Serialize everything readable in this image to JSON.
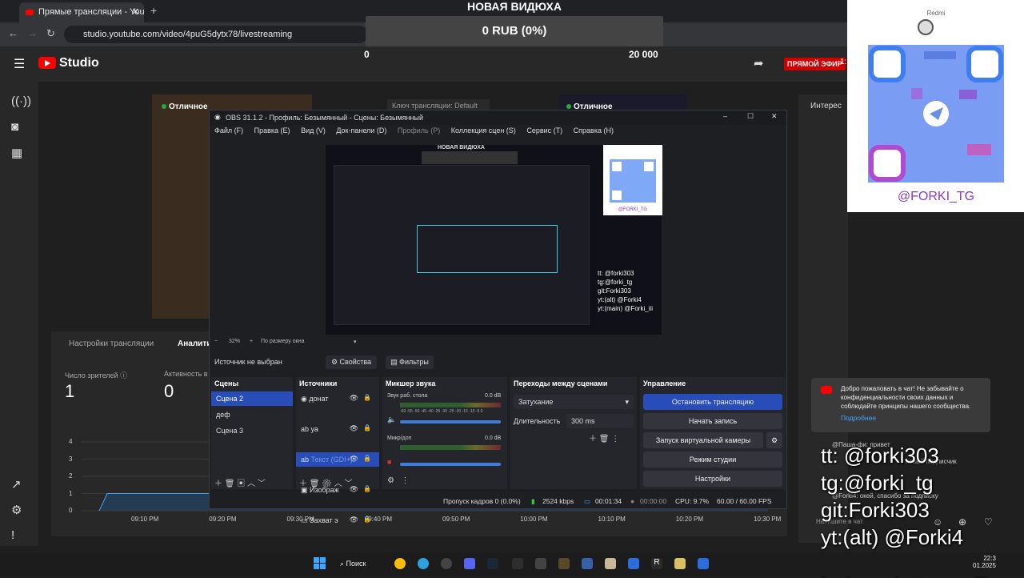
{
  "browser": {
    "tab_title": "Прямые трансляции - YouTub",
    "url": "studio.youtube.com/video/4puG5dytx78/livestreaming"
  },
  "donation": {
    "title": "НОВАЯ ВИДЮХА",
    "amount": "0 RUB (0%)",
    "min": "0",
    "max": "20 000"
  },
  "yt": {
    "logo": "Studio",
    "live_badge": "ПРЯМОЙ ЭФИР",
    "quality_left": "Отличное",
    "quality_right": "Отличное",
    "stream_key_label": "Ключ трансляции: Default",
    "right_card_title": "Интерес",
    "tabs": [
      "Настройки трансляции",
      "Аналити"
    ],
    "viewers_label": "Число зрителей",
    "viewers_value": "1",
    "activity_label": "Активность в ч",
    "activity_value": "0",
    "chart_data": {
      "type": "area",
      "x": [
        "09:10 PM",
        "09:20 PM",
        "09:30 PM",
        "09:40 PM",
        "09:50 PM",
        "10:00 PM",
        "10:10 PM",
        "10:20 PM",
        "10:30 PM"
      ],
      "yticks": [
        "4",
        "3",
        "2",
        "1",
        "0"
      ],
      "ylim": [
        0,
        4
      ],
      "series": [
        {
          "values": [
            1,
            1,
            1,
            1,
            1,
            1,
            1,
            1,
            1
          ]
        }
      ]
    }
  },
  "obs": {
    "title": "OBS 31.1.2 - Профиль: Безымянный - Сцены: Безымянный",
    "menu": [
      "Файл (F)",
      "Правка (E)",
      "Вид (V)",
      "Док-панели (D)",
      "Профиль (P)",
      "Коллекция сцен (S)",
      "Сервис (T)",
      "Справка (H)"
    ],
    "zoom": "32%",
    "zoom_mode": "По размеру окна",
    "no_source": "Источник не выбран",
    "properties": "Свойства",
    "filters": "Фильтры",
    "docks": {
      "scenes": "Сцены",
      "sources": "Источники",
      "mixer": "Микшер звука",
      "transitions": "Переходы между сценами",
      "controls": "Управление"
    },
    "scenes": [
      "Сцена 2",
      "деф",
      "Сцена 3"
    ],
    "sources": [
      "донат",
      "уа",
      "Текст (GDI+)",
      "Изображ",
      "Захват э"
    ],
    "mixer": [
      {
        "name": "Звук раб. стола",
        "db": "0.0 dB"
      },
      {
        "name": "Микр/доп",
        "db": "0.0 dB"
      }
    ],
    "meter_scale": "-60 -55 -50 -45 -40 -35 -30 -25 -20 -15 -10 -5 0",
    "transition": "Затухание",
    "duration_label": "Длительность",
    "duration_value": "300 ms",
    "controls": [
      "Остановить трансляцию",
      "Начать запись",
      "Запуск виртуальной камеры",
      "Режим студии",
      "Настройки"
    ],
    "status": {
      "dropped": "Пропуск кадров 0 (0.0%)",
      "bitrate": "2524 kbps",
      "live_time": "00:01:34",
      "rec_time": "00:00:00",
      "cpu": "CPU: 9.7%",
      "fps": "60.00 / 60.00 FPS"
    }
  },
  "overlay": {
    "qr_brand": "Redmi",
    "qr_caption": "@FORKI_TG",
    "socials": [
      "tt: @forki303",
      "tg:@forki_tg",
      "git:Forki303",
      "yt:(alt) @Forki4",
      "yt:(main) @Forki_iii"
    ]
  },
  "chat": {
    "notice": "Добро пожаловать в чат! Не забывайте о конфиденциальности своих данных и соблюдайте принципы нашего сообщества.",
    "more": "Подробнее",
    "messages": [
      "@Паша-фи: привет",
      "новый подписчик",
      "@Forki4: окей, спасибо за подписку"
    ],
    "input_placeholder": "Напишите в чат"
  },
  "taskbar": {
    "search": "Поиск",
    "time": "22:3",
    "date": "01.2025"
  }
}
